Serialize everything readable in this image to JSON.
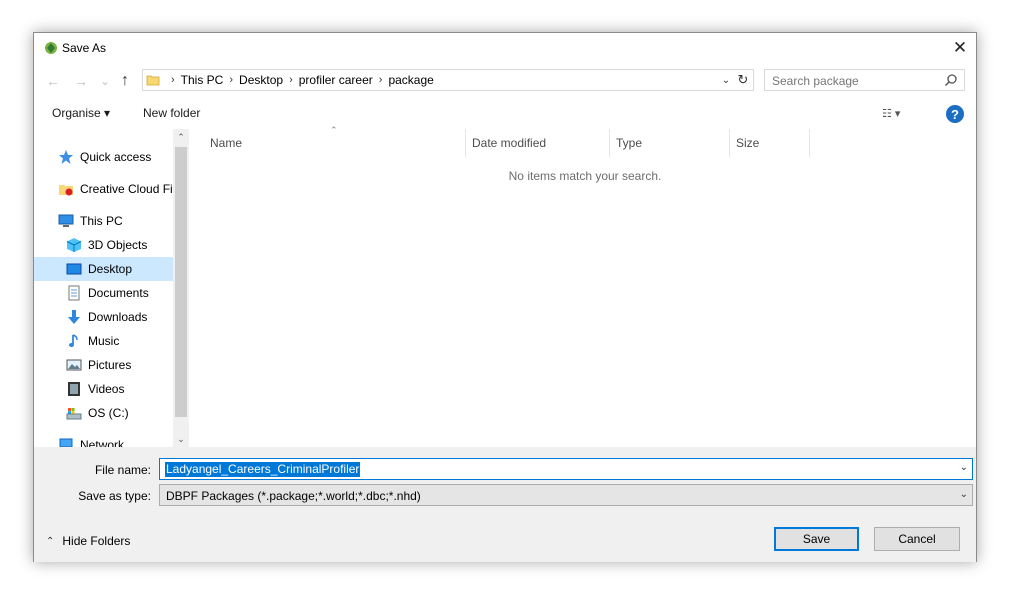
{
  "window": {
    "title": "Save As",
    "close_glyph": "✕"
  },
  "nav": {
    "back_glyph": "←",
    "forward_glyph": "→",
    "recent_glyph": "⌄",
    "up_glyph": "↑",
    "crumb_sep": "›",
    "breadcrumbs": [
      "This PC",
      "Desktop",
      "profiler career",
      "package"
    ],
    "dropdown_glyph": "⌄",
    "refresh_glyph": "↻",
    "search_placeholder": "Search package"
  },
  "toolbar": {
    "organise_label": "Organise ▾",
    "new_folder_label": "New folder",
    "view_glyph": "☷ ▾",
    "help_glyph": "?"
  },
  "sidebar": {
    "items": [
      {
        "label": "Quick access",
        "icon": "star-icon"
      },
      {
        "label": "Creative Cloud Fil",
        "icon": "creative-cloud-icon"
      },
      {
        "label": "This PC",
        "icon": "computer-icon"
      },
      {
        "label": "3D Objects",
        "icon": "cube-icon"
      },
      {
        "label": "Desktop",
        "icon": "desktop-icon",
        "selected": true
      },
      {
        "label": "Documents",
        "icon": "document-icon"
      },
      {
        "label": "Downloads",
        "icon": "download-icon"
      },
      {
        "label": "Music",
        "icon": "music-icon"
      },
      {
        "label": "Pictures",
        "icon": "picture-icon"
      },
      {
        "label": "Videos",
        "icon": "video-icon"
      },
      {
        "label": "OS (C:)",
        "icon": "drive-icon"
      },
      {
        "label": "Network",
        "icon": "network-icon"
      }
    ],
    "scroll_up_glyph": "⌃",
    "scroll_down_glyph": "⌄"
  },
  "file_list": {
    "columns": [
      "Name",
      "Date modified",
      "Type",
      "Size"
    ],
    "sort_glyph": "⌃",
    "empty_message": "No items match your search."
  },
  "footer": {
    "file_name_label": "File name:",
    "file_name_value": "Ladyangel_Careers_CriminalProfiler",
    "save_type_label": "Save as type:",
    "save_type_value": "DBPF Packages (*.package;*.world;*.dbc;*.nhd)",
    "dropdown_glyph": "⌄",
    "hide_folders_label": "Hide Folders",
    "hide_folders_glyph": "⌃",
    "save_label": "Save",
    "cancel_label": "Cancel"
  },
  "colors": {
    "accent": "#0078d7",
    "selection": "#cce8ff",
    "panel": "#f0f0f0"
  }
}
